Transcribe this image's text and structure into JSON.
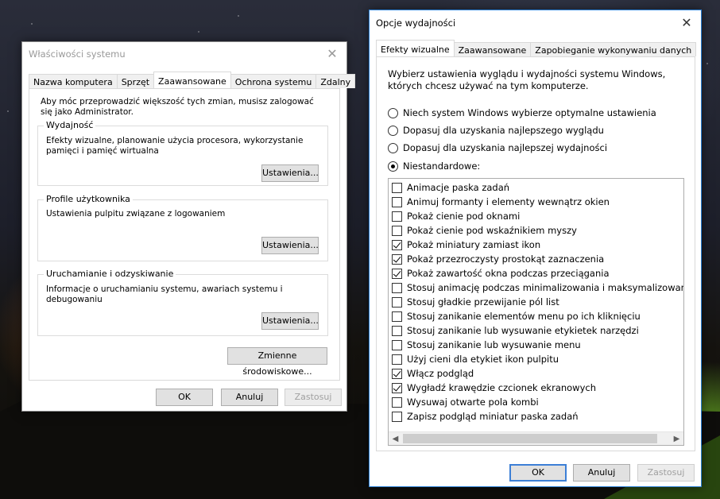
{
  "sysprops": {
    "title": "Właściwości systemu",
    "tabs": [
      "Nazwa komputera",
      "Sprzęt",
      "Zaawansowane",
      "Ochrona systemu",
      "Zdalny"
    ],
    "admin_note": "Aby móc przeprowadzić większość tych zmian, musisz zalogować się jako Administrator.",
    "groups": [
      {
        "title": "Wydajność",
        "text": "Efekty wizualne, planowanie użycia procesora, wykorzystanie pamięci i pamięć wirtualna",
        "button": "Ustawienia..."
      },
      {
        "title": "Profile użytkownika",
        "text": "Ustawienia pulpitu związane z logowaniem",
        "button": "Ustawienia..."
      },
      {
        "title": "Uruchamianie i odzyskiwanie",
        "text": "Informacje o uruchamianiu systemu, awariach systemu i debugowaniu",
        "button": "Ustawienia..."
      }
    ],
    "env_button": "Zmienne środowiskowe...",
    "ok": "OK",
    "cancel": "Anuluj",
    "apply": "Zastosuj"
  },
  "perf": {
    "title": "Opcje wydajności",
    "tabs": [
      "Efekty wizualne",
      "Zaawansowane",
      "Zapobieganie wykonywaniu danych"
    ],
    "intro": "Wybierz ustawienia wyglądu i wydajności systemu Windows, których chcesz używać na tym komputerze.",
    "radios": [
      {
        "label": "Niech system Windows wybierze optymalne ustawienia",
        "selected": false
      },
      {
        "label": "Dopasuj dla uzyskania najlepszego wyglądu",
        "selected": false
      },
      {
        "label": "Dopasuj dla uzyskania najlepszej wydajności",
        "selected": false
      },
      {
        "label": "Niestandardowe:",
        "selected": true
      }
    ],
    "effects": [
      {
        "label": "Animacje paska zadań",
        "checked": false
      },
      {
        "label": "Animuj formanty i elementy wewnątrz okien",
        "checked": false
      },
      {
        "label": "Pokaż cienie pod oknami",
        "checked": false
      },
      {
        "label": "Pokaż cienie pod wskaźnikiem myszy",
        "checked": false
      },
      {
        "label": "Pokaż miniatury zamiast ikon",
        "checked": true
      },
      {
        "label": "Pokaż przezroczysty prostokąt zaznaczenia",
        "checked": true
      },
      {
        "label": "Pokaż zawartość okna podczas przeciągania",
        "checked": true
      },
      {
        "label": "Stosuj animację podczas minimalizowania i maksymalizowania ok",
        "checked": false
      },
      {
        "label": "Stosuj gładkie przewijanie pól list",
        "checked": false
      },
      {
        "label": "Stosuj zanikanie elementów menu po ich kliknięciu",
        "checked": false
      },
      {
        "label": "Stosuj zanikanie lub wysuwanie etykietek narzędzi",
        "checked": false
      },
      {
        "label": "Stosuj zanikanie lub wysuwanie menu",
        "checked": false
      },
      {
        "label": "Użyj cieni dla etykiet ikon pulpitu",
        "checked": false
      },
      {
        "label": "Włącz podgląd",
        "checked": true
      },
      {
        "label": "Wygładź krawędzie czcionek ekranowych",
        "checked": true
      },
      {
        "label": "Wysuwaj otwarte pola kombi",
        "checked": false
      },
      {
        "label": "Zapisz podgląd miniatur paska zadań",
        "checked": false
      }
    ],
    "ok": "OK",
    "cancel": "Anuluj",
    "apply": "Zastosuj"
  },
  "icons": {
    "close": "close-icon",
    "left": "chevron-left-icon",
    "right": "chevron-right-icon"
  }
}
